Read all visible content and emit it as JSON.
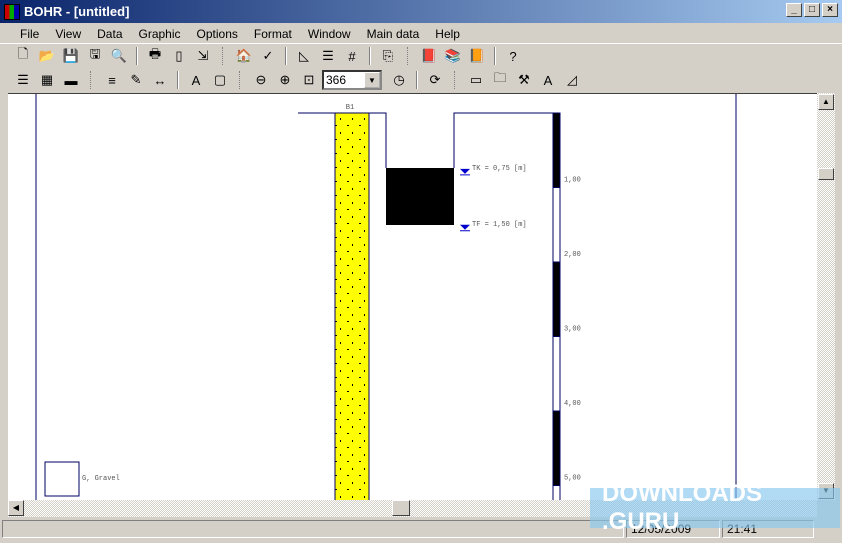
{
  "window": {
    "title": "BOHR - [untitled]",
    "controls": [
      "_",
      "□",
      "×"
    ]
  },
  "menu": [
    "File",
    "View",
    "Data",
    "Graphic",
    "Options",
    "Format",
    "Window",
    "Main data",
    "Help"
  ],
  "toolbar1": [
    "new-icon",
    "open-icon",
    "save-icon",
    "save-as-icon",
    "preview-icon",
    "|",
    "print-icon",
    "page-icon",
    "exit-icon",
    "||",
    "project-icon",
    "check-icon",
    "|",
    "layout-icon",
    "text-icon",
    "number-icon",
    "|",
    "copy-icon",
    "||",
    "book-icon",
    "library-icon",
    "library-add-icon",
    "|",
    "help-icon"
  ],
  "toolbar2": [
    "list-icon",
    "colors-icon",
    "bar-icon",
    "||",
    "lines-icon",
    "paint-icon",
    "width-icon",
    "|",
    "font-icon",
    "page-setup-icon",
    "||",
    "zoom-out-icon",
    "zoom-in-icon",
    "zoom-fit-icon"
  ],
  "toolbar2b": [
    "zoom-clock-icon",
    "|",
    "refresh-icon",
    "||",
    "frame-icon",
    "folder-icon",
    "tools-icon",
    "globe-icon",
    "triangle-icon"
  ],
  "zoom": {
    "value": "366"
  },
  "drawing": {
    "borehole_label": "B1",
    "soil_color": "#ffff00",
    "water_levels": [
      {
        "label": "TK = 0,75 [m]",
        "depth": 0.75
      },
      {
        "label": "TF = 1,50 [m]",
        "depth": 1.5
      }
    ],
    "depth_labels": [
      "1,00",
      "2,00",
      "3,00",
      "4,00",
      "5,00"
    ],
    "legend": {
      "label": "G, Gravel"
    }
  },
  "status": {
    "date": "12/05/2009",
    "time": "21:41"
  },
  "watermark": "DOWNLOADS .GURU"
}
